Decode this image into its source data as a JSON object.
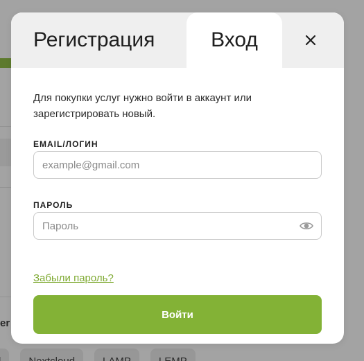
{
  "background": {
    "side_text": "er",
    "tags": [
      "l",
      "Nextcloud",
      "LAMP",
      "LEMP"
    ]
  },
  "modal": {
    "tabs": {
      "register_label": "Регистрация",
      "login_label": "Вход",
      "active": "login"
    },
    "close_icon": "close-icon",
    "intro_text": "Для покупки услуг нужно войти в аккаунт или зарегистрировать новый.",
    "email": {
      "label": "EMAIL/ЛОГИН",
      "placeholder": "example@gmail.com",
      "value": ""
    },
    "password": {
      "label": "ПАРОЛЬ",
      "placeholder": "Пароль",
      "value": "",
      "toggle_icon": "eye-icon"
    },
    "forgot_link": "Забыли пароль?",
    "submit_label": "Войти"
  },
  "colors": {
    "accent": "#83b236",
    "link": "#7faa33",
    "tab_bar": "#efefef",
    "overlay": "#a3a3a3"
  }
}
